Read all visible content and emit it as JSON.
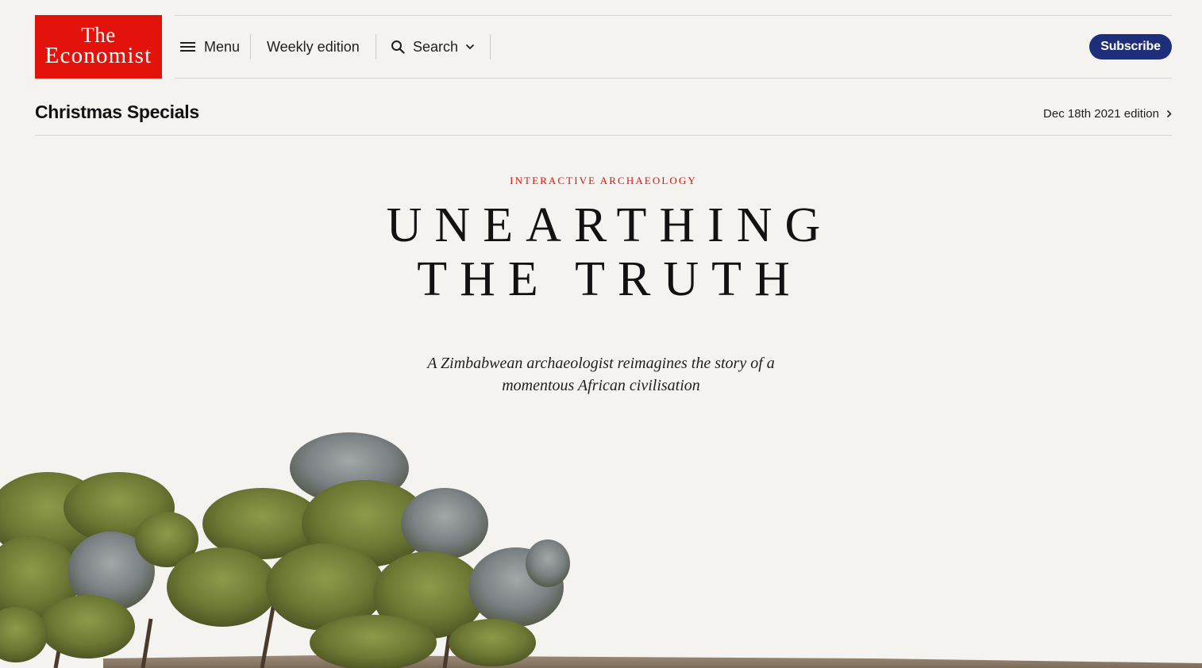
{
  "header": {
    "logo_line1": "The",
    "logo_line2": "Economist",
    "menu_label": "Menu",
    "weekly_edition_label": "Weekly edition",
    "search_label": "Search",
    "subscribe_label": "Subscribe"
  },
  "section": {
    "title": "Christmas Specials",
    "edition_label": "Dec 18th 2021 edition"
  },
  "article": {
    "kicker": "INTERACTIVE ARCHAEOLOGY",
    "headline_line1": "UNEARTHING",
    "headline_line2": "THE TRUTH",
    "standfirst_line1": "A Zimbabwean archaeologist reimagines the story of a",
    "standfirst_line2": "momentous African civilisation"
  },
  "icons": {
    "menu": "hamburger-icon",
    "search": "search-icon",
    "search_dropdown": "chevron-down-icon",
    "edition": "chevron-right-icon"
  },
  "colors": {
    "brand_red": "#e3120b",
    "subscribe_navy": "#1f2e7a",
    "background": "#f4f3ef"
  }
}
